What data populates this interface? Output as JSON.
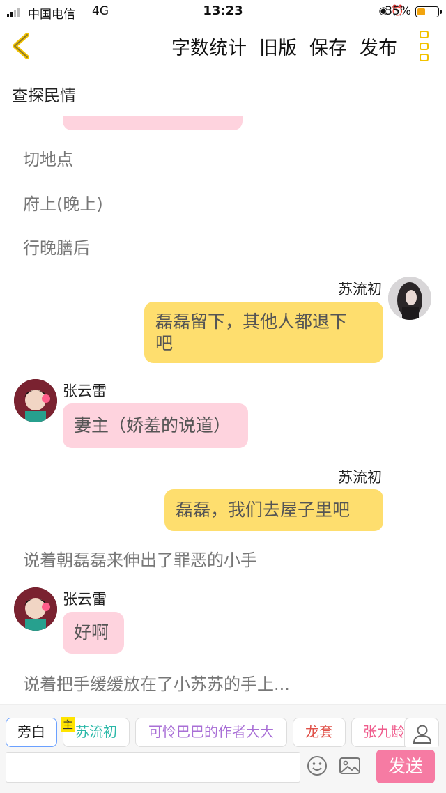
{
  "status_bar": {
    "carrier": "中国电信",
    "network": "4G",
    "time": "13:23",
    "battery_percent": "35%",
    "battery_level": 0.35
  },
  "navbar": {
    "actions": [
      "字数统计",
      "旧版",
      "保存",
      "发布"
    ],
    "accent_color": "#f2c200"
  },
  "chapter_title": "查探民情",
  "messages": {
    "narration_1": "切地点",
    "narration_2": "府上(晚上)",
    "narration_3": "行晚膳后",
    "sender_1": "苏流初",
    "bubble_1_line1": "磊磊留下，其他人都退下",
    "bubble_1_line2": "吧",
    "sender_2": "张云雷",
    "bubble_2": "妻主（娇羞的说道）",
    "sender_3": "苏流初",
    "bubble_3": "磊磊，我们去屋子里吧",
    "narration_4": "说着朝磊磊来伸出了罪恶的小手",
    "sender_4": "张云雷",
    "bubble_4": "好啊",
    "narration_5": "说着把手缓缓放在了小苏苏的手上..."
  },
  "characters": {
    "narrator": "旁白",
    "main_badge": "主",
    "c1": "苏流初",
    "c2": "可怜巴巴的作者大大",
    "c3": "龙套",
    "c4": "张九龄"
  },
  "composer": {
    "value": "",
    "send_label": "发送"
  },
  "colors": {
    "pink_bubble": "#fed3de",
    "yellow_bubble": "#fede6e",
    "send_button": "#f67ba3"
  }
}
